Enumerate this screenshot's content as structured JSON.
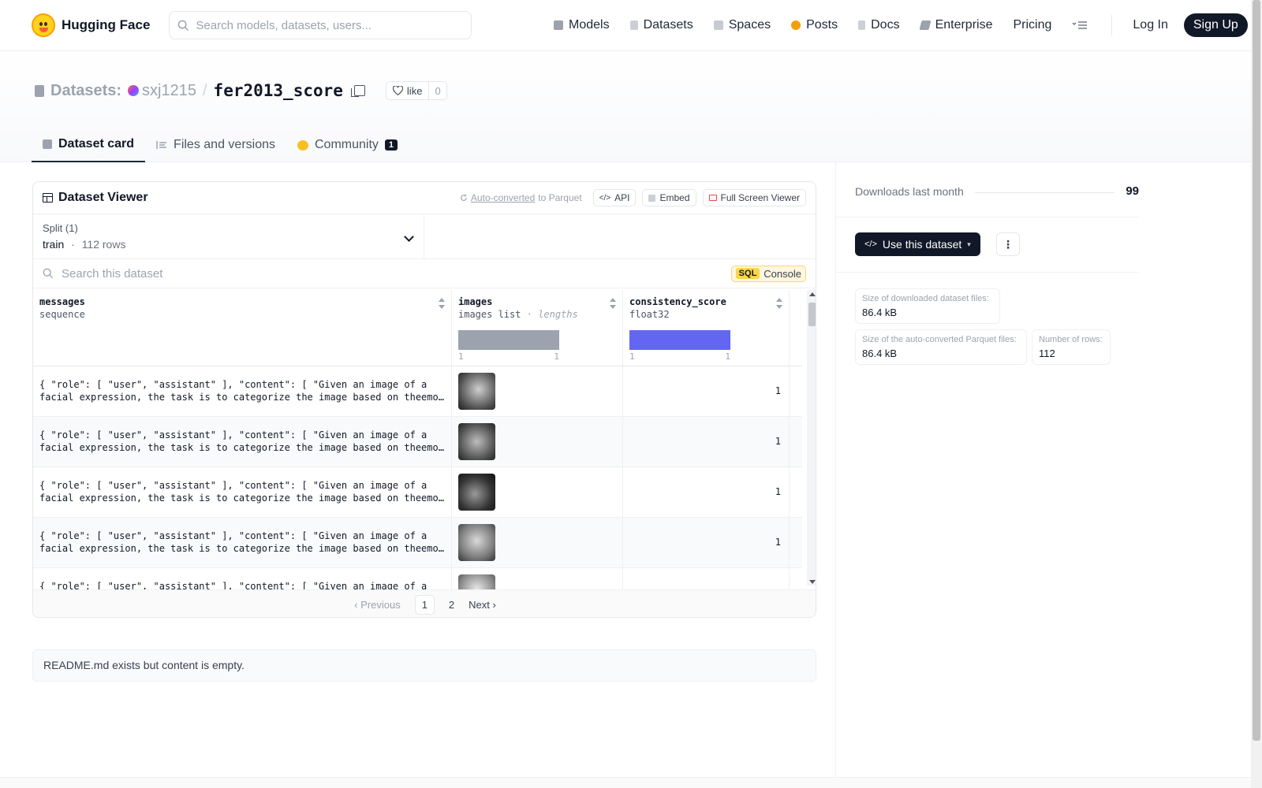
{
  "nav": {
    "brand": "Hugging Face",
    "search_placeholder": "Search models, datasets, users...",
    "items": [
      "Models",
      "Datasets",
      "Spaces",
      "Posts",
      "Docs",
      "Enterprise",
      "Pricing"
    ],
    "login": "Log In",
    "signup": "Sign Up"
  },
  "header": {
    "section": "Datasets:",
    "owner": "sxj1215",
    "separator": "/",
    "name": "fer2013_score",
    "like_label": "like",
    "like_count": "0",
    "tabs": {
      "card": "Dataset card",
      "files": "Files and versions",
      "community": "Community",
      "community_badge": "1"
    }
  },
  "viewer": {
    "title": "Dataset Viewer",
    "autoconv_link": "Auto-converted",
    "autoconv_suffix": "to Parquet",
    "api": "API",
    "embed": "Embed",
    "fullscreen": "Full Screen Viewer",
    "split_label": "Split (1)",
    "split_name": "train",
    "split_dot": "·",
    "split_rows": "112 rows",
    "search_placeholder": "Search this dataset",
    "sql_tag": "SQL",
    "console": "Console",
    "columns": {
      "messages": {
        "name": "messages",
        "type": "sequence"
      },
      "images": {
        "name": "images",
        "type": "images list",
        "type_dot": "·",
        "type_extra": "lengths",
        "hist_min": "1",
        "hist_max": "1"
      },
      "score": {
        "name": "consistency_score",
        "type": "float32",
        "hist_min": "1",
        "hist_max": "1"
      }
    },
    "rows": [
      {
        "line1": "{ \"role\": [ \"user\", \"assistant\" ], \"content\": [ \"Given an image of a",
        "line2": "facial expression, the task is to categorize the image based on theemotion…",
        "score": "1"
      },
      {
        "line1": "{ \"role\": [ \"user\", \"assistant\" ], \"content\": [ \"Given an image of a",
        "line2": "facial expression, the task is to categorize the image based on theemotion…",
        "score": "1"
      },
      {
        "line1": "{ \"role\": [ \"user\", \"assistant\" ], \"content\": [ \"Given an image of a",
        "line2": "facial expression, the task is to categorize the image based on theemotion…",
        "score": "1"
      },
      {
        "line1": "{ \"role\": [ \"user\", \"assistant\" ], \"content\": [ \"Given an image of a",
        "line2": "facial expression, the task is to categorize the image based on theemotion…",
        "score": "1"
      },
      {
        "line1": "{ \"role\": [ \"user\", \"assistant\" ], \"content\": [ \"Given an image of a",
        "line2": "",
        "score": ""
      }
    ],
    "pager": {
      "previous": "Previous",
      "pages": [
        "1",
        "2"
      ],
      "current_page": "1",
      "next": "Next"
    }
  },
  "readme_note": "README.md exists but content is empty.",
  "sidebar": {
    "downloads_label": "Downloads last month",
    "downloads_value": "99",
    "use_button": "Use this dataset",
    "stats": {
      "downloaded_label": "Size of downloaded dataset files:",
      "downloaded_value": "86.4 kB",
      "parquet_label": "Size of the auto-converted Parquet files:",
      "parquet_value": "86.4 kB",
      "rows_label": "Number of rows:",
      "rows_value": "112"
    }
  },
  "colors": {
    "images_hist": "#9ca3af",
    "score_hist": "#6366f1",
    "brand_yellow": "#ffd21e",
    "primary_dark": "#111827"
  }
}
